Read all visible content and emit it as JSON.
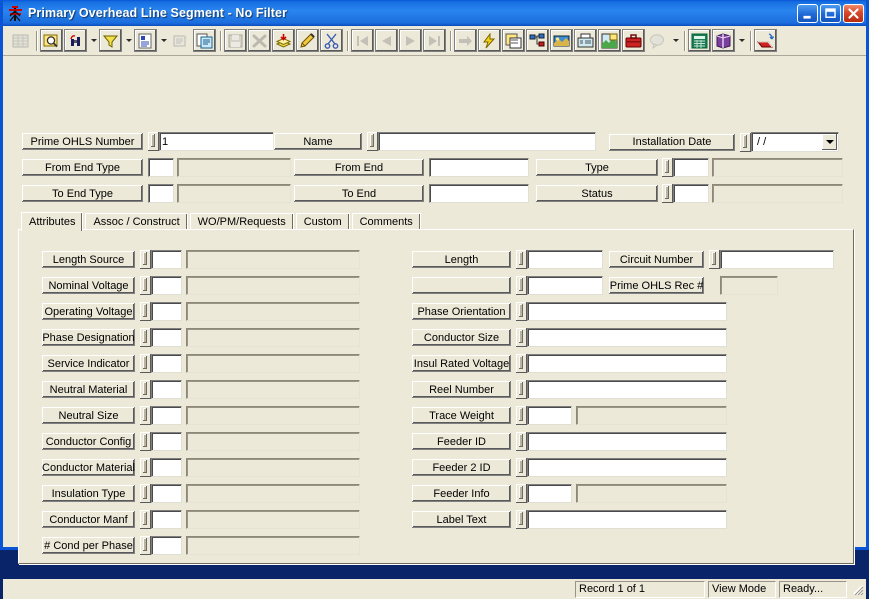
{
  "window": {
    "title": "Primary Overhead Line Segment  -  No Filter",
    "app_icon": "transmission-tower-icon",
    "minimize_label": "Minimize",
    "maximize_label": "Maximize",
    "close_label": "Close",
    "accent_color": "#0a55d6",
    "face_color": "#ece9d8"
  },
  "toolbar": {
    "groups": [
      {
        "buttons": [
          {
            "name": "grid-view-icon",
            "tooltip": "Grid View",
            "disabled": true,
            "framed": false,
            "dropdown": false
          },
          {
            "name": "query-icon",
            "tooltip": "Query",
            "disabled": false,
            "framed": true,
            "dropdown": false
          },
          {
            "name": "find-binoculars-icon",
            "tooltip": "Find",
            "disabled": false,
            "framed": true,
            "dropdown": true
          },
          {
            "name": "filter-funnel-icon",
            "tooltip": "Filter",
            "disabled": false,
            "framed": true,
            "dropdown": true
          },
          {
            "name": "report-icon",
            "tooltip": "Report",
            "disabled": false,
            "framed": true,
            "dropdown": true
          },
          {
            "name": "properties-icon",
            "tooltip": "Properties",
            "disabled": true,
            "framed": false,
            "dropdown": false
          },
          {
            "name": "copy-record-icon",
            "tooltip": "Copy Record",
            "disabled": false,
            "framed": true,
            "dropdown": false
          }
        ]
      },
      {
        "buttons": [
          {
            "name": "save-icon",
            "tooltip": "Save",
            "disabled": true,
            "framed": true,
            "dropdown": false
          },
          {
            "name": "delete-x-icon",
            "tooltip": "Delete",
            "disabled": true,
            "framed": true,
            "dropdown": false
          },
          {
            "name": "insert-record-icon",
            "tooltip": "Insert",
            "disabled": false,
            "framed": true,
            "dropdown": false
          },
          {
            "name": "edit-pencil-icon",
            "tooltip": "Edit",
            "disabled": false,
            "framed": true,
            "dropdown": false
          },
          {
            "name": "cut-scissors-icon",
            "tooltip": "Cut",
            "disabled": false,
            "framed": true,
            "dropdown": false
          }
        ]
      },
      {
        "buttons": [
          {
            "name": "first-record-icon",
            "tooltip": "First Record",
            "disabled": true,
            "framed": true,
            "dropdown": false
          },
          {
            "name": "previous-record-icon",
            "tooltip": "Previous Record",
            "disabled": true,
            "framed": true,
            "dropdown": false
          },
          {
            "name": "next-record-icon",
            "tooltip": "Next Record",
            "disabled": true,
            "framed": true,
            "dropdown": false
          },
          {
            "name": "last-record-icon",
            "tooltip": "Last Record",
            "disabled": true,
            "framed": true,
            "dropdown": false
          }
        ]
      },
      {
        "buttons": [
          {
            "name": "goto-record-icon",
            "tooltip": "Go To",
            "disabled": true,
            "framed": true,
            "dropdown": false
          },
          {
            "name": "lightning-icon",
            "tooltip": "Execute",
            "disabled": false,
            "framed": true,
            "dropdown": false
          },
          {
            "name": "map-select-icon",
            "tooltip": "Map Select",
            "disabled": false,
            "framed": true,
            "dropdown": false
          },
          {
            "name": "hierarchy-icon",
            "tooltip": "Hierarchy",
            "disabled": false,
            "framed": true,
            "dropdown": false
          },
          {
            "name": "map-view-icon",
            "tooltip": "Map View",
            "disabled": false,
            "framed": true,
            "dropdown": false
          },
          {
            "name": "fax-icon",
            "tooltip": "Fax",
            "disabled": false,
            "framed": true,
            "dropdown": false
          },
          {
            "name": "picture-map-icon",
            "tooltip": "Picture",
            "disabled": false,
            "framed": true,
            "dropdown": false
          },
          {
            "name": "toolbox-icon",
            "tooltip": "Tools",
            "disabled": false,
            "framed": true,
            "dropdown": false
          },
          {
            "name": "balloon-help-icon",
            "tooltip": "Help Balloon",
            "disabled": true,
            "framed": false,
            "dropdown": true
          }
        ]
      },
      {
        "buttons": [
          {
            "name": "calculator-icon",
            "tooltip": "Calculator",
            "disabled": false,
            "framed": true,
            "dropdown": false
          },
          {
            "name": "book-icon",
            "tooltip": "Reference",
            "disabled": false,
            "framed": true,
            "dropdown": true
          }
        ]
      },
      {
        "buttons": [
          {
            "name": "exit-icon",
            "tooltip": "Exit",
            "disabled": false,
            "framed": true,
            "dropdown": false
          }
        ]
      }
    ]
  },
  "header": {
    "prime_ohls_number": {
      "label": "Prime OHLS Number",
      "value": "1",
      "has_lov": true
    },
    "name": {
      "label": "Name",
      "value": "",
      "has_lov": true
    },
    "installation_date": {
      "label": "Installation Date",
      "value": "/  /",
      "has_lov": true,
      "dropdown": true
    },
    "from_end_type": {
      "label": "From End Type",
      "code": "",
      "description": ""
    },
    "from_end": {
      "label": "From End",
      "code": "",
      "description": ""
    },
    "type": {
      "label": "Type",
      "code": "",
      "description": ""
    },
    "to_end_type": {
      "label": "To End Type",
      "code": "",
      "description": ""
    },
    "to_end": {
      "label": "To End",
      "code": "",
      "description": ""
    },
    "status": {
      "label": "Status",
      "code": "",
      "description": ""
    }
  },
  "tabs": [
    {
      "label": "Attributes",
      "active": true
    },
    {
      "label": "Assoc / Construct",
      "active": false
    },
    {
      "label": "WO/PM/Requests",
      "active": false
    },
    {
      "label": "Custom",
      "active": false
    },
    {
      "label": "Comments",
      "active": false
    }
  ],
  "attributes": {
    "left_column": [
      {
        "label": "Length Source",
        "code": "",
        "description": ""
      },
      {
        "label": "Nominal Voltage",
        "code": "",
        "description": ""
      },
      {
        "label": "Operating Voltage",
        "code": "",
        "description": ""
      },
      {
        "label": "Phase Designation",
        "code": "",
        "description": ""
      },
      {
        "label": "Service Indicator",
        "code": "",
        "description": ""
      },
      {
        "label": "Neutral Material",
        "code": "",
        "description": ""
      },
      {
        "label": "Neutral Size",
        "code": "",
        "description": ""
      },
      {
        "label": "Conductor Config",
        "code": "",
        "description": ""
      },
      {
        "label": "Conductor Material",
        "code": "",
        "description": ""
      },
      {
        "label": "Insulation Type",
        "code": "",
        "description": ""
      },
      {
        "label": "Conductor Manf",
        "code": "",
        "description": ""
      },
      {
        "label": "# Cond per Phase",
        "code": "",
        "description": ""
      }
    ],
    "right_column": [
      {
        "label": "Length",
        "type": "short",
        "value": ""
      },
      {
        "label": "",
        "type": "short",
        "value": ""
      },
      {
        "label": "Phase Orientation",
        "type": "wide",
        "value": ""
      },
      {
        "label": "Conductor Size",
        "type": "wide",
        "value": ""
      },
      {
        "label": "Insul Rated Voltage",
        "type": "wide",
        "value": ""
      },
      {
        "label": "Reel Number",
        "type": "wide",
        "value": ""
      },
      {
        "label": "Trace Weight",
        "type": "split",
        "value": "",
        "description": ""
      },
      {
        "label": "Feeder ID",
        "type": "wide",
        "value": ""
      },
      {
        "label": "Feeder 2 ID",
        "type": "wide",
        "value": ""
      },
      {
        "label": "Feeder Info",
        "type": "split",
        "value": "",
        "description": ""
      },
      {
        "label": "Label Text",
        "type": "wide",
        "value": ""
      }
    ],
    "far_right": [
      {
        "label": "Circuit Number",
        "value": "",
        "has_lov": true,
        "readonly": false
      },
      {
        "label": "Prime OHLS Rec #",
        "value": "",
        "has_lov": false,
        "readonly": true
      }
    ]
  },
  "status_bar": {
    "record": "Record 1 of 1",
    "mode": "View Mode",
    "state": "Ready..."
  }
}
